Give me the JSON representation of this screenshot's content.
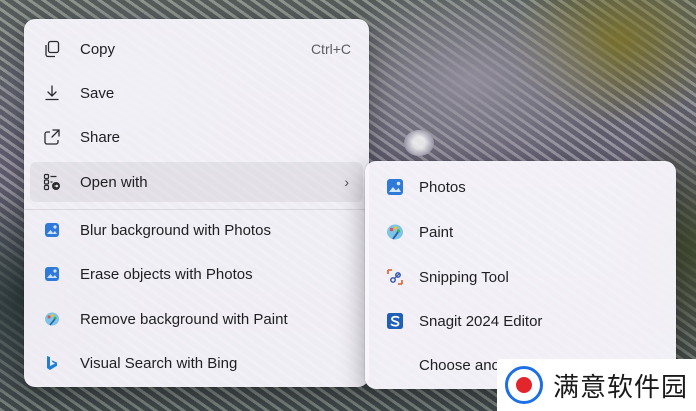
{
  "context_menu": {
    "items": [
      {
        "label": "Copy",
        "shortcut": "Ctrl+C",
        "icon": "copy-icon"
      },
      {
        "label": "Save",
        "icon": "download-icon"
      },
      {
        "label": "Share",
        "icon": "share-icon"
      },
      {
        "label": "Open with",
        "icon": "open-with-icon",
        "submenu_indicator": "›"
      },
      {
        "label": "Blur background with Photos",
        "icon": "photos-icon"
      },
      {
        "label": "Erase objects with Photos",
        "icon": "photos-icon"
      },
      {
        "label": "Remove background with Paint",
        "icon": "paint-icon"
      },
      {
        "label": "Visual Search with Bing",
        "icon": "bing-icon"
      }
    ]
  },
  "open_with_submenu": {
    "items": [
      {
        "label": "Photos",
        "icon": "photos-app-icon"
      },
      {
        "label": "Paint",
        "icon": "paint-app-icon"
      },
      {
        "label": "Snipping Tool",
        "icon": "snipping-tool-icon"
      },
      {
        "label": "Snagit 2024 Editor",
        "icon": "snagit-icon"
      },
      {
        "label": "Choose anot",
        "icon": ""
      }
    ]
  },
  "watermark": {
    "text": "满意软件园"
  },
  "colors": {
    "menu_bg": "#f8f6fc",
    "text": "#1f1f22",
    "photos_blue": "#2f7ad8",
    "snagit_blue": "#1f5fb8",
    "watermark_blue": "#1e6fe6",
    "watermark_red": "#e3262b"
  }
}
